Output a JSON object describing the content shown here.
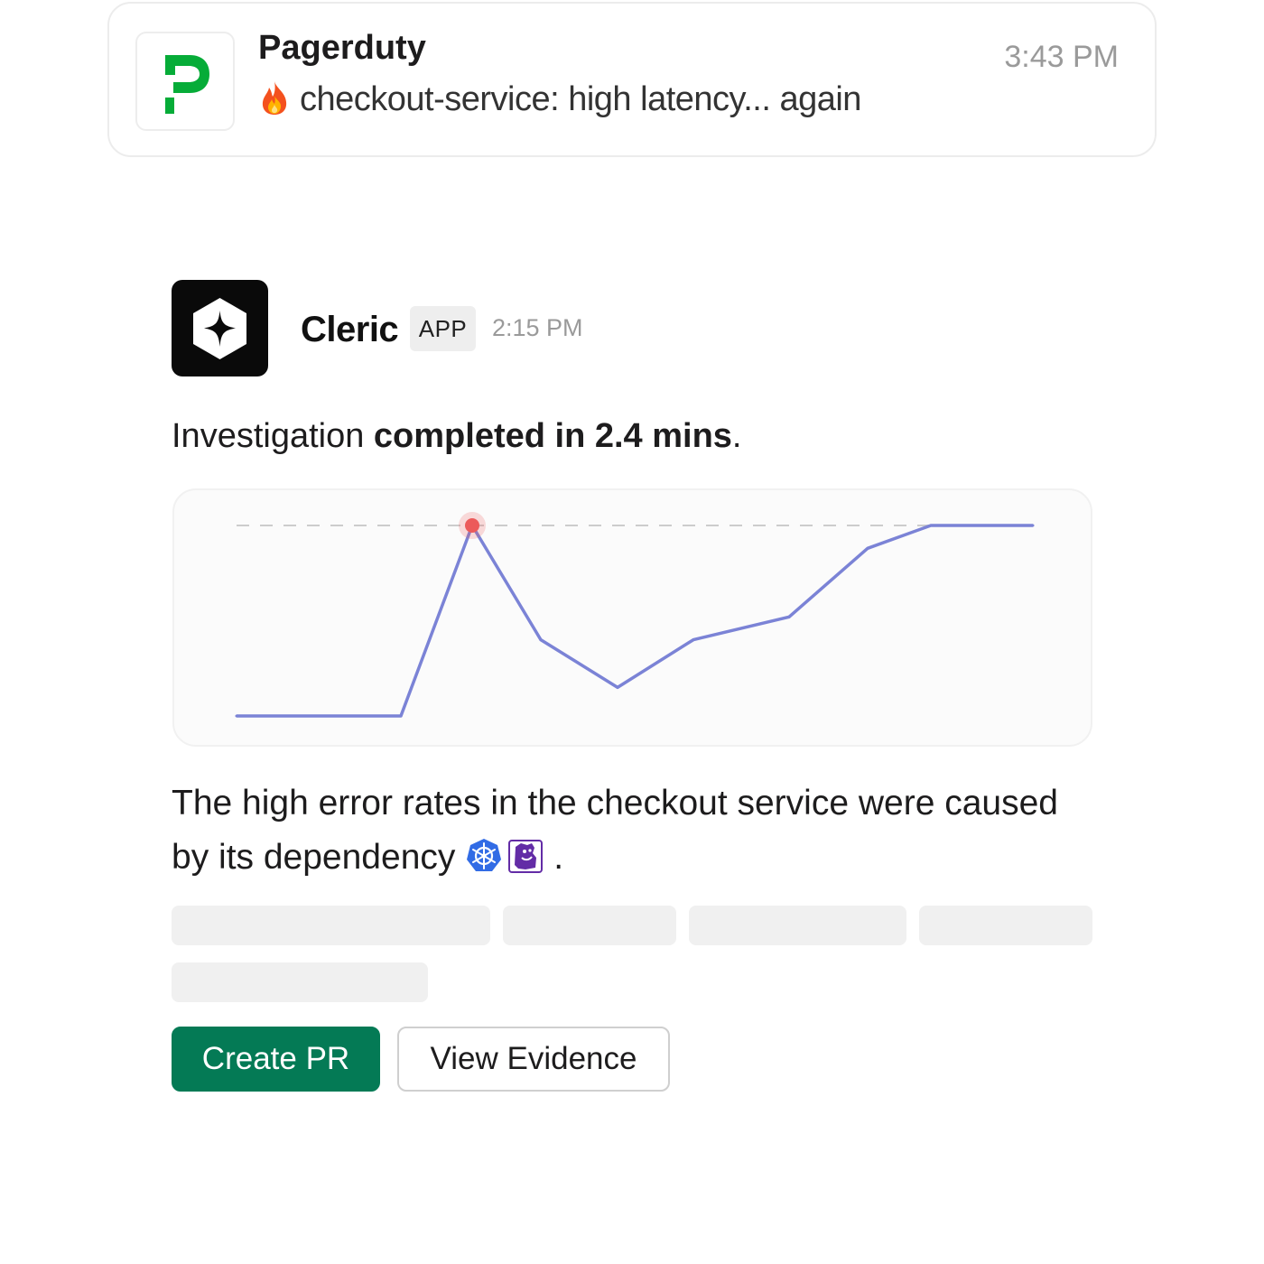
{
  "notification": {
    "app_name": "Pagerduty",
    "message": "checkout-service: high latency... again",
    "time": "3:43 PM",
    "logo_icon": "pagerduty-logo",
    "emoji_icon": "fire-emoji",
    "brand_color": "#06ac38"
  },
  "message": {
    "sender": "Cleric",
    "badge": "APP",
    "time": "2:15 PM",
    "avatar_icon": "cleric-logo",
    "summary_prefix": "Investigation ",
    "summary_bold": "completed in 2.4 mins",
    "summary_suffix": ".",
    "explanation": "The high error rates in the checkout service were caused by its dependency",
    "explanation_suffix": ".",
    "dependency_icons": [
      "kubernetes-icon",
      "datadog-icon"
    ]
  },
  "chart_data": {
    "type": "line",
    "x": [
      0,
      1,
      2,
      3,
      4,
      5,
      6,
      7,
      8,
      9,
      10
    ],
    "values": [
      0,
      0,
      1.0,
      0.4,
      0.15,
      0.4,
      0.52,
      0.88,
      1.0,
      1.0,
      1.0
    ],
    "ylim": [
      0,
      1
    ],
    "threshold": 1.0,
    "highlight_index": 2,
    "grid": false,
    "colors": {
      "line": "#7b83d6",
      "threshold": "#cccccc",
      "marker": "#ec5a5a"
    }
  },
  "actions": {
    "create_pr": "Create PR",
    "view_evidence": "View Evidence",
    "primary_color": "#047a55"
  }
}
